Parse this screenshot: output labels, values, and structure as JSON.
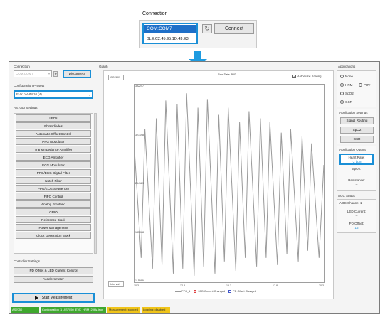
{
  "popup": {
    "title": "Connection",
    "port_selected": "COM:COM7",
    "port_option_2": "BLE:C2:45:95:1D:43:E3",
    "connect_label": "Connect"
  },
  "left": {
    "connection_label": "Connection",
    "port_value": "COM:COM7",
    "disconnect_label": "Disconnect",
    "presets_label": "Configuration Presets",
    "preset_value": "EVK: WHM 10 (4)",
    "settings_label": "AS7050 Settings",
    "settings_items": [
      "LEDs",
      "Photodiodes",
      "Automatic Offset Control",
      "PPG Modulator",
      "Transimpedance Amplifier",
      "ECG Amplifier",
      "ECG Modulator",
      "PPG/ECG Digital Filter",
      "Notch Filter",
      "PPG/ECG Sequencer",
      "FIFO Control",
      "Analog Frontend",
      "GPIO",
      "Reference Block",
      "Power Management",
      "Clock Generation Block"
    ],
    "controller_label": "Controller Settings",
    "controller_items": [
      "PD Offset & LED Current Control",
      "Accelerometer"
    ],
    "start_label": "Start Measurement"
  },
  "graph": {
    "section_label": "Graph",
    "select_value": "CO2807",
    "auto_scaling_label": "Automatic Scaling",
    "bottom_select_value": "Interval"
  },
  "right": {
    "applications_label": "Applications",
    "apps": [
      "None",
      "HRM",
      "PRV",
      "SpO2",
      "GSR"
    ],
    "selected_app": "HRM",
    "app_settings_label": "Application Settings",
    "app_settings_buttons": [
      "Signal Routing",
      "SpO2",
      "GSR"
    ],
    "app_output_label": "Application Output",
    "heart_rate_label": "Heart Rate:",
    "heart_rate_value": "72 bpm",
    "spo2_label": "SpO2:",
    "spo2_value": "--",
    "resistance_label": "Resistance:",
    "resistance_value": "--",
    "agc_status_label": "AGC Status",
    "agc_channel_label": "AGC Channel 1",
    "led_current_label": "LED Current:",
    "led_current_value": "--",
    "pd_offset_label": "PD Offset:",
    "pd_offset_value": "15"
  },
  "status": {
    "device": "AS7050",
    "config": "Configuration_1_AS7050_EVK_HRM_20Hz.json",
    "measurement": "Measurement: stopped",
    "logging": "Logging: disabled"
  },
  "colors": {
    "highlight": "#1a8fd6",
    "arrow": "#1e9be0",
    "status_green": "#3fa82e",
    "status_yellow": "#f0c419",
    "trace": "#9a9a9a"
  },
  "chart_data": {
    "type": "line",
    "title": "Raw Data PPG",
    "y_tick_labels": [
      "392247",
      "323198",
      "254129",
      "185068",
      "115999"
    ],
    "x_tick_labels": [
      "10.3",
      "12.8",
      "15.3",
      "17.8",
      "20.3"
    ],
    "xlim": [
      10.3,
      20.3
    ],
    "ylim": [
      115999,
      392247
    ],
    "grid": false,
    "legend": [
      "PPG_1",
      "LED Current Changed",
      "PD Offset Changed"
    ],
    "legend_placement": "bottom",
    "series": [
      {
        "name": "PPG_1",
        "x": [
          10.3,
          10.65,
          10.85,
          11.25,
          11.45,
          11.75,
          11.95,
          12.35,
          12.55,
          12.85,
          13.05,
          13.45,
          13.65,
          13.95,
          14.15,
          14.55,
          14.75,
          15.05,
          15.25,
          15.65,
          15.85,
          16.15,
          16.35,
          16.75,
          16.95,
          17.25,
          17.45,
          17.85,
          18.05,
          18.35,
          18.55,
          18.95,
          19.15,
          19.45,
          19.65,
          20.05,
          20.3
        ],
        "y": [
          300000,
          150000,
          330000,
          135000,
          345000,
          140000,
          370000,
          128000,
          365000,
          135000,
          380000,
          125000,
          360000,
          138000,
          372000,
          128000,
          350000,
          145000,
          360000,
          132000,
          340000,
          150000,
          355000,
          138000,
          345000,
          150000,
          340000,
          140000,
          325000,
          155000,
          330000,
          145000,
          320000,
          160000,
          310000,
          150000,
          280000
        ]
      }
    ]
  }
}
